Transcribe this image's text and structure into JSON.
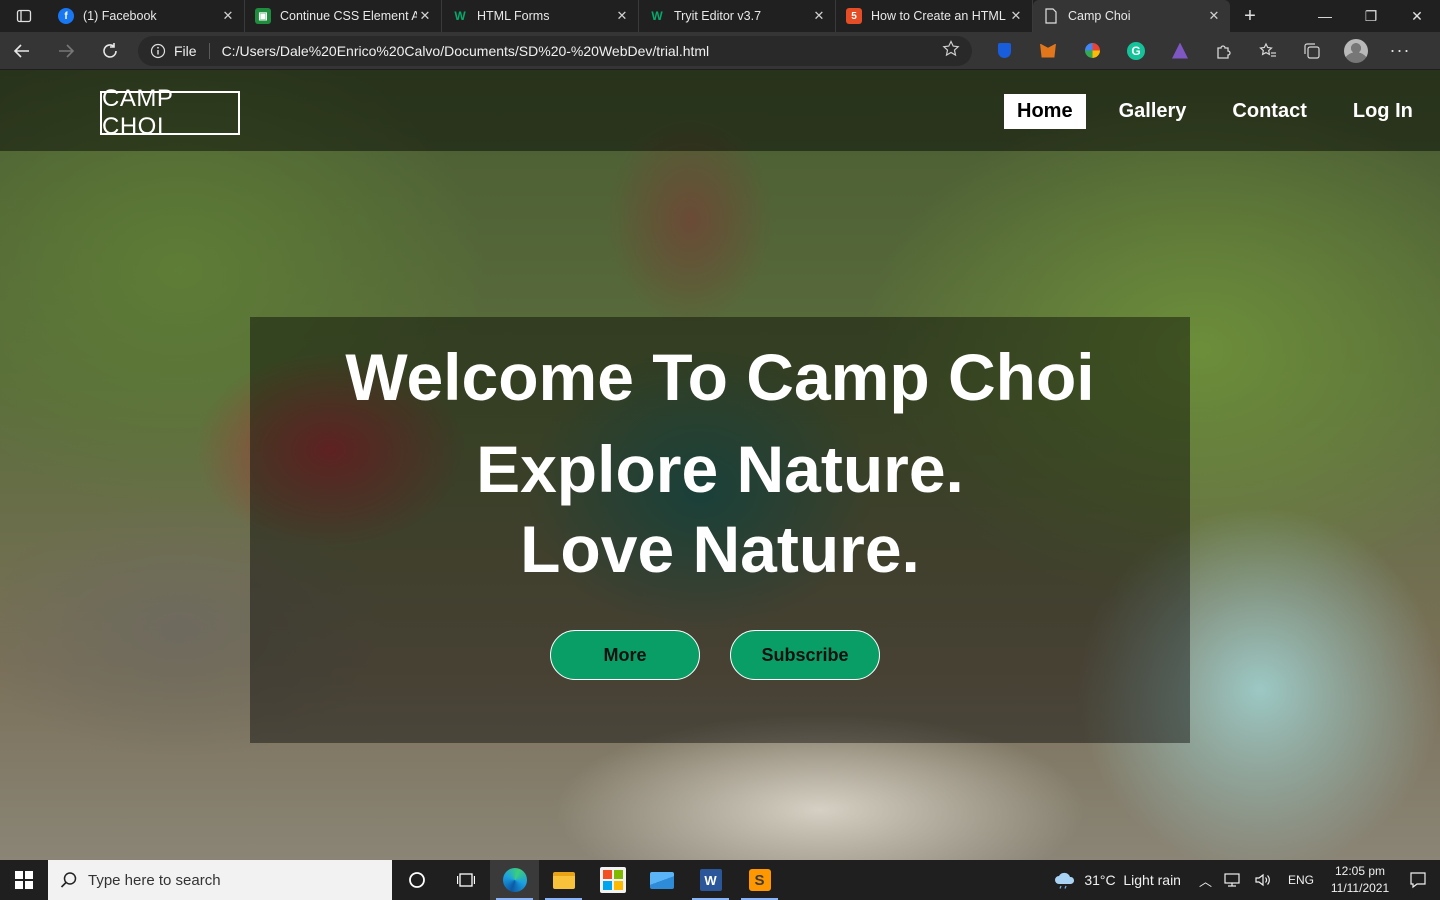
{
  "browser": {
    "tabs": [
      {
        "title": "(1) Facebook",
        "icon": "facebook-icon",
        "color": "#1877f2"
      },
      {
        "title": "Continue CSS Element A",
        "icon": "classroom-icon",
        "color": "#1e8e3e"
      },
      {
        "title": "HTML Forms",
        "icon": "w3schools-icon",
        "color": "#04aa6d"
      },
      {
        "title": "Tryit Editor v3.7",
        "icon": "w3schools-icon",
        "color": "#04aa6d"
      },
      {
        "title": "How to Create an HTML",
        "icon": "html-icon",
        "color": "#e44d26"
      },
      {
        "title": "Camp Choi",
        "icon": "page-icon",
        "color": "#cccccc"
      }
    ],
    "address": {
      "scheme_label": "File",
      "url": "C:/Users/Dale%20Enrico%20Calvo/Documents/SD%20-%20WebDev/trial.html"
    }
  },
  "site": {
    "logo": "CAMP CHOI",
    "nav": [
      {
        "label": "Home",
        "active": true
      },
      {
        "label": "Gallery",
        "active": false
      },
      {
        "label": "Contact",
        "active": false
      },
      {
        "label": "Log In",
        "active": false
      }
    ],
    "hero": {
      "title": "Welcome To Camp Choi",
      "line1": "Explore Nature.",
      "line2": "Love Nature.",
      "buttons": [
        "More",
        "Subscribe"
      ]
    },
    "accent_color": "#0a9e67"
  },
  "taskbar": {
    "search_placeholder": "Type here to search",
    "weather": "31°C  Light rain",
    "language": "ENG",
    "time": "12:05 pm",
    "date": "11/11/2021"
  }
}
